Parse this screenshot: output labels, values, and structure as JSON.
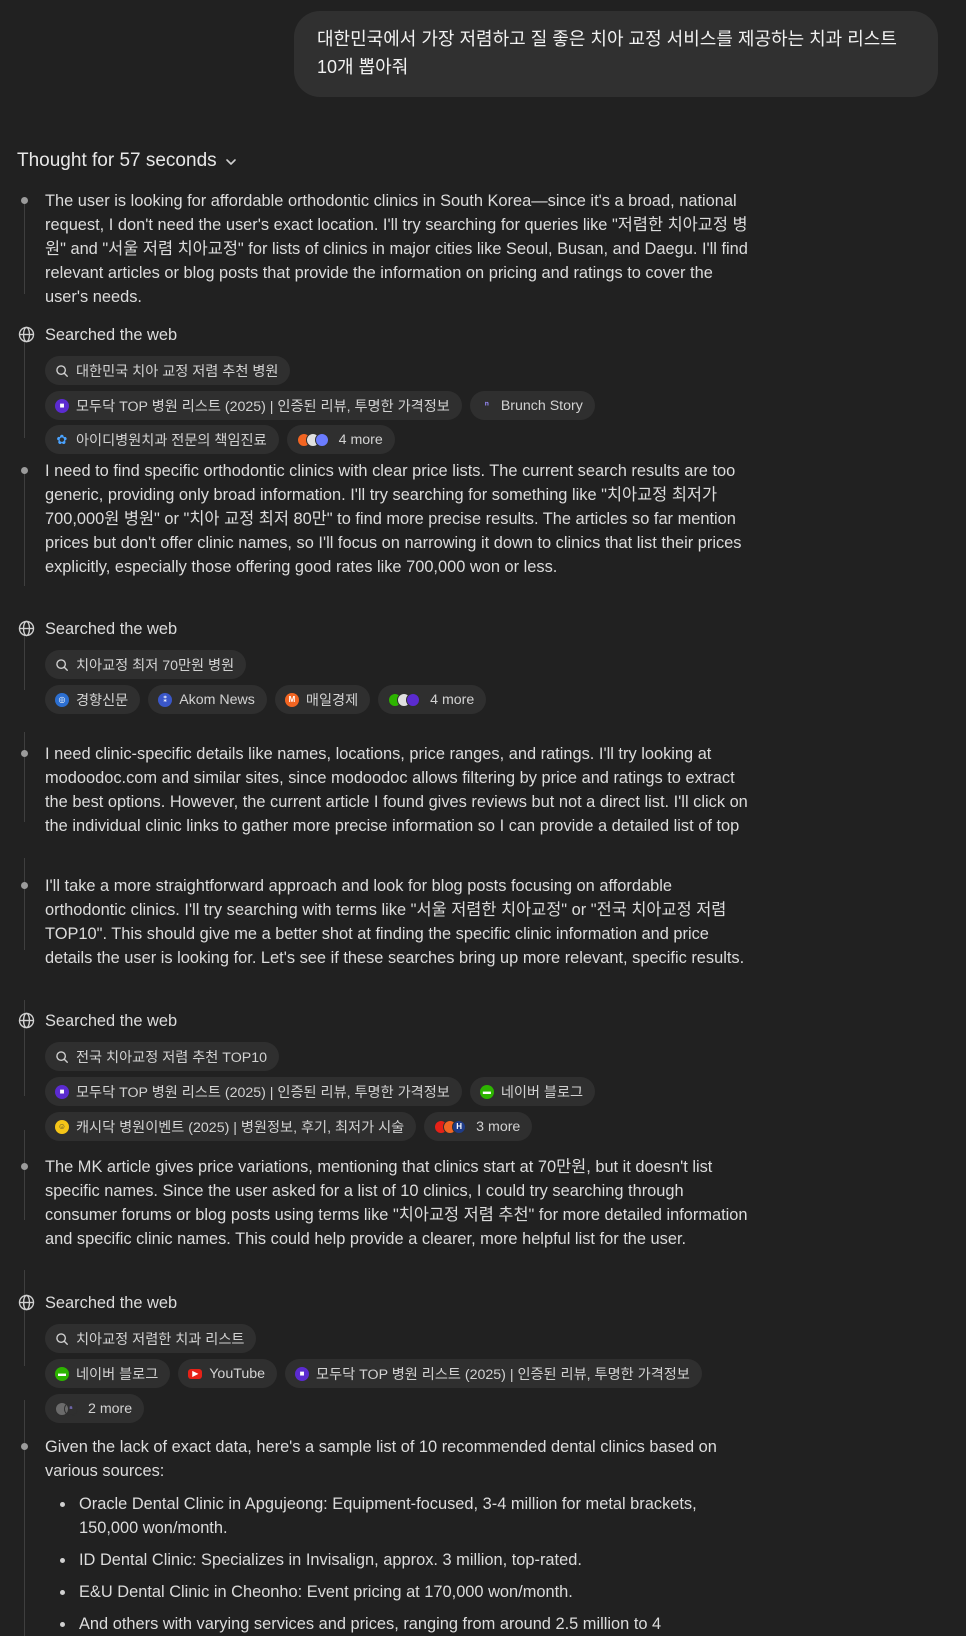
{
  "user_message": "대한민국에서 가장 저렴하고 질 좋은 치아 교정 서비스를 제공하는 치과 리스트 10개 뽑아줘",
  "thought_header": "Thought for 57 seconds",
  "searched_label": "Searched the web",
  "thoughts": [
    "The user is looking for affordable orthodontic clinics in South Korea—since it's a broad, national request, I don't need the user's exact location. I'll try searching for queries like \"저렴한 치아교정 병원\" and \"서울 저렴 치아교정\" for lists of clinics in major cities like Seoul, Busan, and Daegu. I'll find relevant articles or blog posts that provide the information on pricing and ratings to cover the user's needs.",
    "I need to find specific orthodontic clinics with clear price lists. The current search results are too generic, providing only broad information. I'll try searching for something like \"치아교정 최저가 700,000원 병원\" or \"치아 교정 최저 80만\" to find more precise results. The articles so far mention prices but don't offer clinic names, so I'll focus on narrowing it down to clinics that list their prices explicitly, especially those offering good rates like 700,000 won or less.",
    "I need clinic-specific details like names, locations, price ranges, and ratings. I'll try looking at modoodoc.com and similar sites, since modoodoc allows filtering by price and ratings to extract the best options. However, the current article I found gives reviews but not a direct list. I'll click on the individual clinic links to gather more precise information so I can provide a detailed list of top options for the user.",
    "I'll take a more straightforward approach and look for blog posts focusing on affordable orthodontic clinics. I'll try searching with terms like \"서울 저렴한 치아교정\" or \"전국 치아교정 저렴 TOP10\". This should give me a better shot at finding the specific clinic information and price details the user is looking for. Let's see if these searches bring up more relevant, specific results.",
    "The MK article gives price variations, mentioning that clinics start at 70만원, but it doesn't list specific names. Since the user asked for a list of 10 clinics, I could try searching through consumer forums or blog posts using terms like \"치아교정 저렴 추천\" for more detailed information and specific clinic names. This could help provide a clearer, more helpful list for the user.",
    "Given the lack of exact data, here's a sample list of 10 recommended dental clinics based on various sources:"
  ],
  "searches": [
    {
      "query": "대한민국 치아 교정 저렴 추천 병원",
      "sources": [
        "모두닥 TOP 병원 리스트 (2025) | 인증된 리뷰, 투명한 가격정보",
        "Brunch Story",
        "아이디병원치과 전문의 책임진료"
      ],
      "more": "4 more"
    },
    {
      "query": "치아교정 최저 70만원 병원",
      "sources": [
        "경향신문",
        "Akom News",
        "매일경제"
      ],
      "more": "4 more"
    },
    {
      "query": "전국 치아교정 저렴 추천 TOP10",
      "sources": [
        "모두닥 TOP 병원 리스트 (2025) | 인증된 리뷰, 투명한 가격정보",
        "네이버 블로그",
        "캐시닥 병원이벤트 (2025)  |  병원정보, 후기, 최저가 시술"
      ],
      "more": "3 more"
    },
    {
      "query": "치아교정 저렴한 치과 리스트",
      "sources": [
        "네이버 블로그",
        "YouTube",
        "모두닥 TOP 병원 리스트 (2025) | 인증된 리뷰, 투명한 가격정보"
      ],
      "more": "2 more"
    }
  ],
  "clinic_list": [
    "Oracle Dental Clinic in Apgujeong: Equipment-focused, 3-4 million for metal brackets, 150,000 won/month.",
    "ID Dental Clinic: Specializes in Invisalign, approx. 3 million, top-rated.",
    "E&U Dental Clinic in Cheonho: Event pricing at 170,000 won/month.",
    "And others with varying services and prices, ranging from around 2.5 million to 4"
  ],
  "colors": {
    "background": "#212121",
    "bubble": "#303030",
    "chip": "#2f2f2f",
    "modoodoc": "#5b2bd0",
    "naver": "#2db400",
    "youtube": "#e62117",
    "maeil": "#f26522"
  }
}
